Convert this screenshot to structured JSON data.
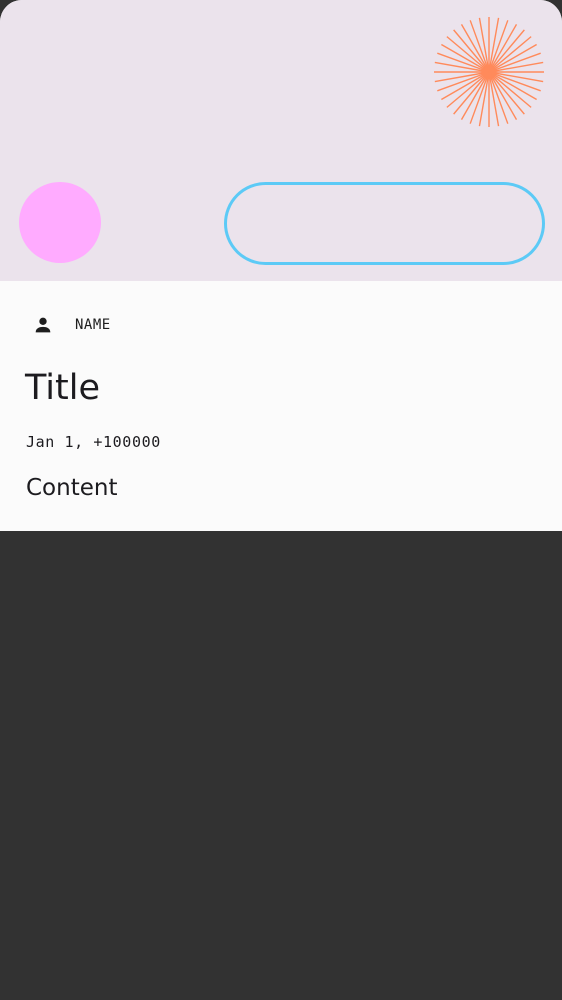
{
  "card": {
    "author_name": "NAME",
    "title": "Title",
    "date": "Jan 1, +100000",
    "content": "Content"
  },
  "colors": {
    "header_bg": "#ebe3ec",
    "avatar": "#ffabff",
    "pill_border": "#5ccaf6",
    "sunburst": "#ff8a5b",
    "card_bg": "#fbfbfb",
    "page_bg": "#323232"
  },
  "icons": {
    "author": "person-icon",
    "decoration": "sunburst-icon"
  }
}
